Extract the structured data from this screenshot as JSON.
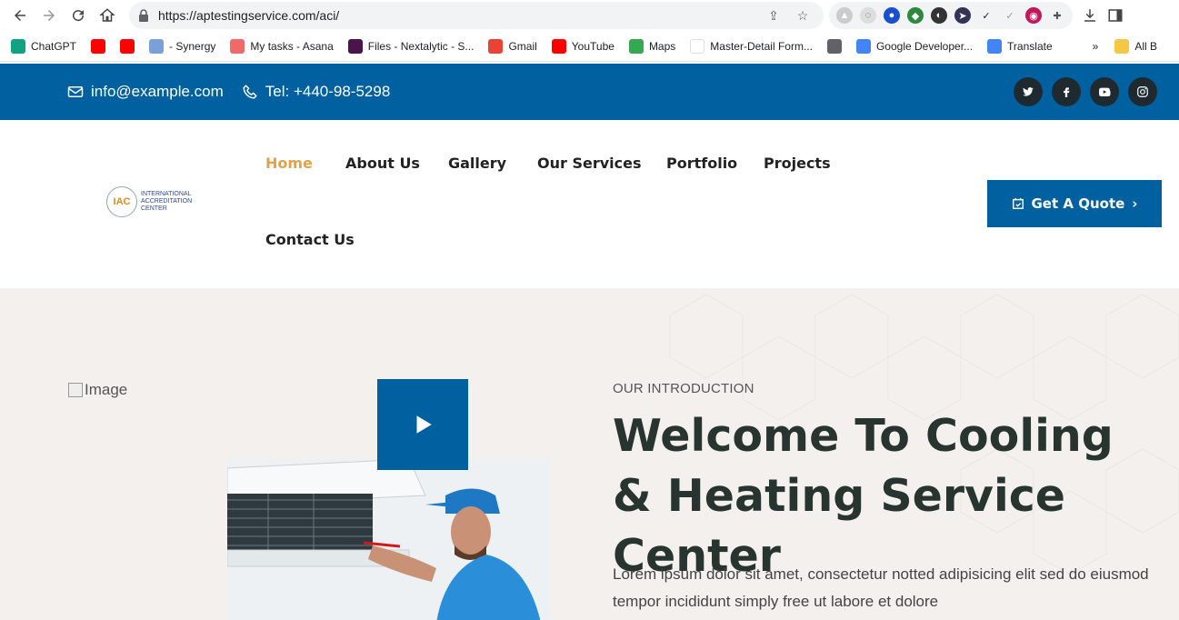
{
  "browser": {
    "url": "https://aptestingservice.com/aci/",
    "bookmarks": [
      {
        "label": "ChatGPT",
        "icon": "chatgpt-icon",
        "color": "#10a37f"
      },
      {
        "label": "",
        "icon": "youtube-icon",
        "color": "#ff0000"
      },
      {
        "label": "",
        "icon": "youtube-icon",
        "color": "#ff0000"
      },
      {
        "label": "- Synergy",
        "icon": "doc-icon",
        "color": "#7aa0d8"
      },
      {
        "label": "My tasks - Asana",
        "icon": "asana-icon",
        "color": "#f06a6a"
      },
      {
        "label": "Files - Nextalytic - S...",
        "icon": "slack-icon",
        "color": "#4a154b"
      },
      {
        "label": "Gmail",
        "icon": "gmail-icon",
        "color": "#ea4335"
      },
      {
        "label": "YouTube",
        "icon": "youtube-icon",
        "color": "#ff0000"
      },
      {
        "label": "Maps",
        "icon": "maps-icon",
        "color": "#34a853"
      },
      {
        "label": "Master-Detail Form...",
        "icon": "blank-icon",
        "color": "#ffffff"
      },
      {
        "label": "",
        "icon": "globe-icon",
        "color": "#5f6368"
      },
      {
        "label": "Google Developer...",
        "icon": "google-icon",
        "color": "#4285f4"
      },
      {
        "label": "Translate",
        "icon": "translate-icon",
        "color": "#4285f4"
      }
    ],
    "more_bookmarks": "»",
    "all_bookmarks": "All B"
  },
  "topbar": {
    "email": "info@example.com",
    "phone": "Tel: +440-98-5298",
    "socials": [
      "twitter-icon",
      "facebook-icon",
      "youtube-icon",
      "instagram-icon"
    ]
  },
  "header": {
    "logo_abbr": "IAC",
    "logo_line1": "INTERNATIONAL",
    "logo_line2": "ACCREDITATION",
    "logo_line3": "CENTER",
    "nav": [
      "Home",
      "About Us",
      "Gallery",
      "Our Services",
      "Portfolio",
      "Projects",
      "Contact Us"
    ],
    "quote_button": "Get A Quote"
  },
  "hero": {
    "image_alt": "Image",
    "intro_label": "OUR INTRODUCTION",
    "title": "Welcome To Cooling & Heating Service Center",
    "text": "Lorem ipsum dolor sit amet, consectetur notted adipisicing elit sed do eiusmod tempor incididunt simply free ut labore et dolore"
  },
  "colors": {
    "primary": "#0060a0",
    "accent": "#e0a24a",
    "dark": "#27342f",
    "hero_bg": "#f4f0ee"
  }
}
